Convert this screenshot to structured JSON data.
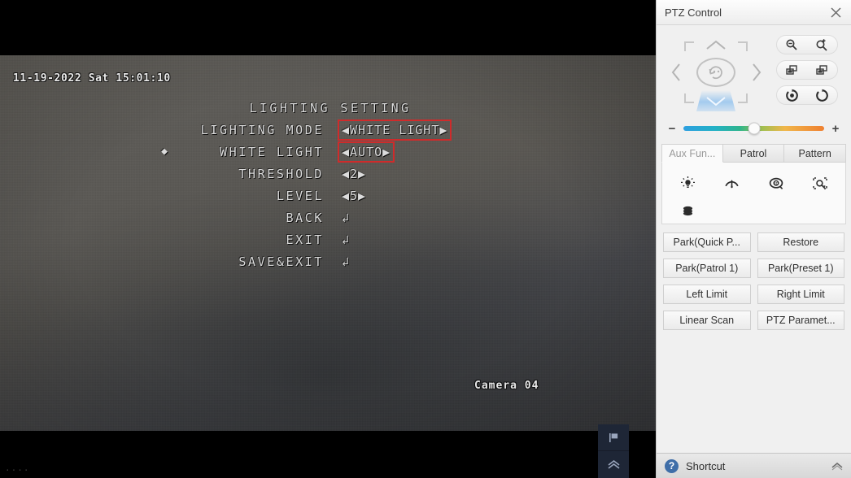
{
  "video": {
    "timestamp": "11-19-2022 Sat 15:01:10",
    "camera_label": "Camera 04",
    "corner_marks": "....",
    "osd": {
      "title": "LIGHTING SETTING",
      "rows": [
        {
          "cursor": "",
          "label": "LIGHTING MODE",
          "value": "◀WHITE LIGHT▶",
          "highlight": true,
          "type": "select"
        },
        {
          "cursor": "◆",
          "label": "WHITE LIGHT",
          "value": "◀AUTO▶",
          "highlight": true,
          "type": "select"
        },
        {
          "cursor": "",
          "label": "THRESHOLD",
          "value": "◀2▶",
          "highlight": false,
          "type": "select"
        },
        {
          "cursor": "",
          "label": "LEVEL",
          "value": "◀5▶",
          "highlight": false,
          "type": "select"
        },
        {
          "cursor": "",
          "label": "BACK",
          "value": "↲",
          "highlight": false,
          "type": "enter"
        },
        {
          "cursor": "",
          "label": "EXIT",
          "value": "↲",
          "highlight": false,
          "type": "enter"
        },
        {
          "cursor": "",
          "label": "SAVE&EXIT",
          "value": "↲",
          "highlight": false,
          "type": "enter"
        }
      ]
    },
    "tools": [
      {
        "name": "zoom-in-button",
        "glyph": "+"
      },
      {
        "name": "zoom-out-button",
        "glyph": "−"
      },
      {
        "name": "preset-flag-button",
        "glyph": "flag"
      },
      {
        "name": "expand-toolbar-button",
        "glyph": "chevrons-up"
      }
    ]
  },
  "ptz": {
    "header": {
      "title": "PTZ Control",
      "close_label": "×"
    },
    "dpad": {
      "up_label": "⌃",
      "down_label": "⌄",
      "left_label": "‹",
      "right_label": "›",
      "center_label": "auto-scan"
    },
    "lens": {
      "zoom": {
        "out_label": "zoom-out",
        "in_label": "zoom-in"
      },
      "focus": {
        "near_label": "focus-near",
        "far_label": "focus-far"
      },
      "iris": {
        "close_label": "iris-close",
        "open_label": "iris-open"
      }
    },
    "speed": {
      "minus_label": "−",
      "plus_label": "+",
      "value": 50
    },
    "tabs": [
      {
        "label": "Aux Fun...",
        "active": true
      },
      {
        "label": "Patrol",
        "active": false
      },
      {
        "label": "Pattern",
        "active": false
      }
    ],
    "aux_buttons": [
      {
        "name": "light-icon",
        "title": "Light"
      },
      {
        "name": "wiper-icon",
        "title": "Wiper"
      },
      {
        "name": "lens-initialize-icon",
        "title": "Lens Initialization"
      },
      {
        "name": "auxiliary-focus-icon",
        "title": "Auxiliary Focus"
      },
      {
        "name": "manual-tracking-icon",
        "title": "Manual Tracking"
      }
    ],
    "function_buttons": [
      "Park(Quick P...",
      "Restore",
      "Park(Patrol 1)",
      "Park(Preset 1)",
      "Left Limit",
      "Right Limit",
      "Linear Scan",
      "PTZ Paramet..."
    ],
    "footer": {
      "help_glyph": "?",
      "label": "Shortcut"
    }
  },
  "colors": {
    "panel_bg": "#f0f0f0",
    "highlight_red": "#cf2b2b",
    "accent_blue": "#8abeee",
    "help_blue": "#3f6ea8"
  }
}
